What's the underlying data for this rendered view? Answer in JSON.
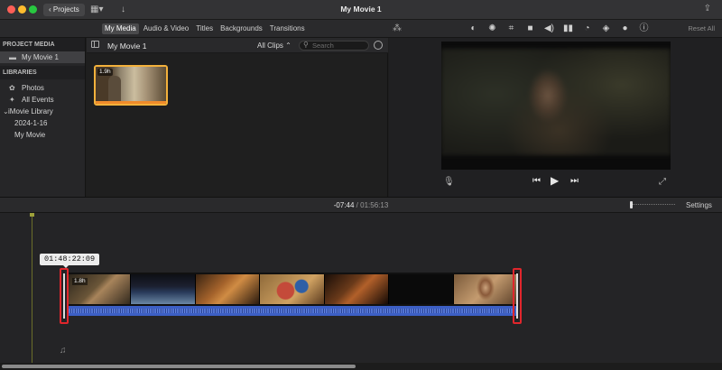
{
  "titlebar": {
    "projects_label": "Projects",
    "window_title": "My Movie 1"
  },
  "tabs": [
    {
      "label": "My Media",
      "active": true
    },
    {
      "label": "Audio & Video",
      "active": false
    },
    {
      "label": "Titles",
      "active": false
    },
    {
      "label": "Backgrounds",
      "active": false
    },
    {
      "label": "Transitions",
      "active": false
    }
  ],
  "viewer_toolbar": {
    "icons": [
      "color-balance-icon",
      "color-correction-icon",
      "crop-icon",
      "stabilization-icon",
      "volume-icon",
      "equalizer-icon",
      "speed-icon",
      "noise-reduction-icon",
      "clip-filter-icon",
      "info-icon"
    ],
    "reset_all": "Reset All"
  },
  "sidebar": {
    "project_media_header": "PROJECT MEDIA",
    "project_item": "My Movie 1",
    "libraries_header": "LIBRARIES",
    "photos": "Photos",
    "all_events": "All Events",
    "library": "iMovie Library",
    "event_date": "2024-1-16",
    "event_movie": "My Movie"
  },
  "browser": {
    "title": "My Movie 1",
    "filter": "All Clips",
    "search_placeholder": "Search",
    "clip_duration": "1.9h"
  },
  "timeline": {
    "current_time": "-07:44",
    "separator": "/",
    "total_time": "01:56:13",
    "settings_label": "Settings",
    "trim_timecode": "01:48:22:09",
    "clip_label": "1.8h"
  },
  "colors": {
    "accent_selection": "#f3b13c",
    "trim_handle": "#e0262c",
    "audio_track": "#3c5fc5"
  }
}
